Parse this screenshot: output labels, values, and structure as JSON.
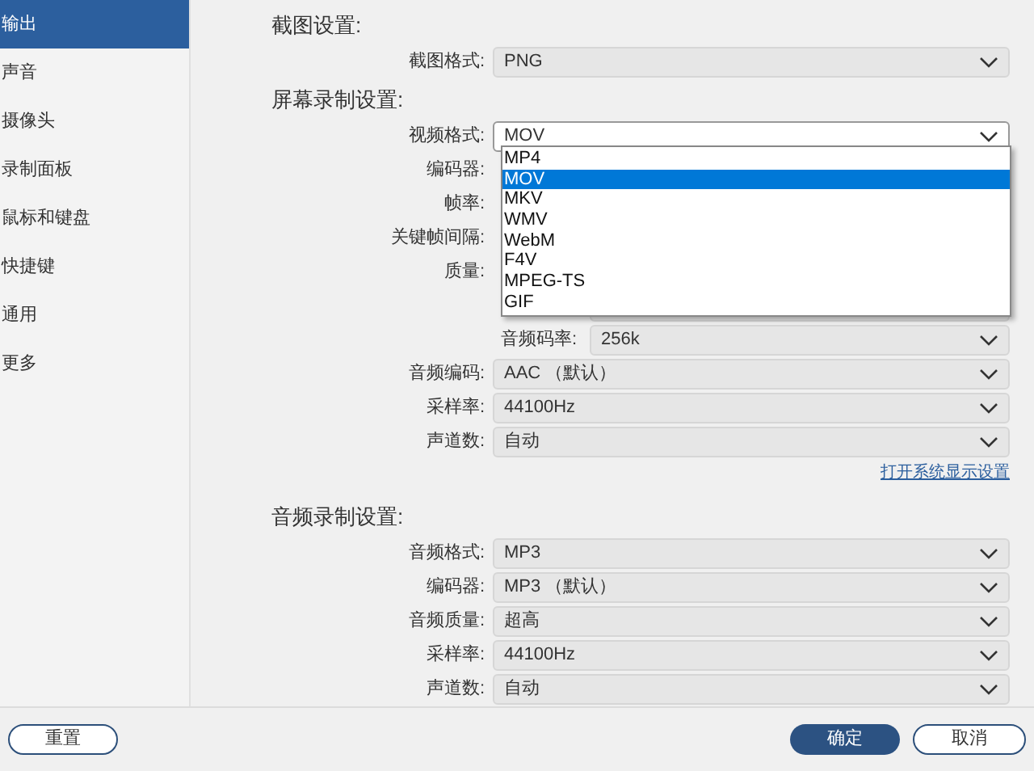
{
  "sidebar": {
    "items": [
      {
        "label": "输出",
        "selected": true
      },
      {
        "label": "声音",
        "selected": false
      },
      {
        "label": "摄像头",
        "selected": false
      },
      {
        "label": "录制面板",
        "selected": false
      },
      {
        "label": "鼠标和键盘",
        "selected": false
      },
      {
        "label": "快捷键",
        "selected": false
      },
      {
        "label": "通用",
        "selected": false
      },
      {
        "label": "更多",
        "selected": false
      }
    ]
  },
  "sections": [
    {
      "title": "截图设置:",
      "rows": [
        {
          "kind": "select",
          "label": "截图格式:",
          "value": "PNG"
        }
      ]
    },
    {
      "title": "屏幕录制设置:",
      "rows": [
        {
          "kind": "open",
          "label": "视频格式:",
          "value": "MOV"
        },
        {
          "kind": "covered",
          "label": "编码器:"
        },
        {
          "kind": "covered",
          "label": "帧率:"
        },
        {
          "kind": "covered",
          "label": "关键帧间隔:"
        },
        {
          "kind": "covered",
          "label": "质量:"
        },
        {
          "kind": "sub-covered"
        },
        {
          "kind": "sub",
          "label": "音频码率:",
          "value": "256k"
        },
        {
          "kind": "select",
          "label": "音频编码:",
          "value": "AAC （默认）"
        },
        {
          "kind": "select",
          "label": "采样率:",
          "value": "44100Hz"
        },
        {
          "kind": "select",
          "label": "声道数:",
          "value": "自动"
        }
      ],
      "link": "打开系统显示设置"
    },
    {
      "title": "音频录制设置:",
      "rows": [
        {
          "kind": "select",
          "label": "音频格式:",
          "value": "MP3"
        },
        {
          "kind": "select",
          "label": "编码器:",
          "value": "MP3 （默认）"
        },
        {
          "kind": "select",
          "label": "音频质量:",
          "value": "超高"
        },
        {
          "kind": "select",
          "label": "采样率:",
          "value": "44100Hz"
        },
        {
          "kind": "select",
          "label": "声道数:",
          "value": "自动"
        }
      ]
    }
  ],
  "dropdown": {
    "options": [
      {
        "label": "MP4",
        "selected": false
      },
      {
        "label": "MOV",
        "selected": true
      },
      {
        "label": "MKV",
        "selected": false
      },
      {
        "label": "WMV",
        "selected": false
      },
      {
        "label": "WebM",
        "selected": false
      },
      {
        "label": "F4V",
        "selected": false
      },
      {
        "label": "MPEG-TS",
        "selected": false
      },
      {
        "label": "GIF",
        "selected": false
      }
    ]
  },
  "footer": {
    "reset": "重置",
    "ok": "确定",
    "cancel": "取消"
  }
}
